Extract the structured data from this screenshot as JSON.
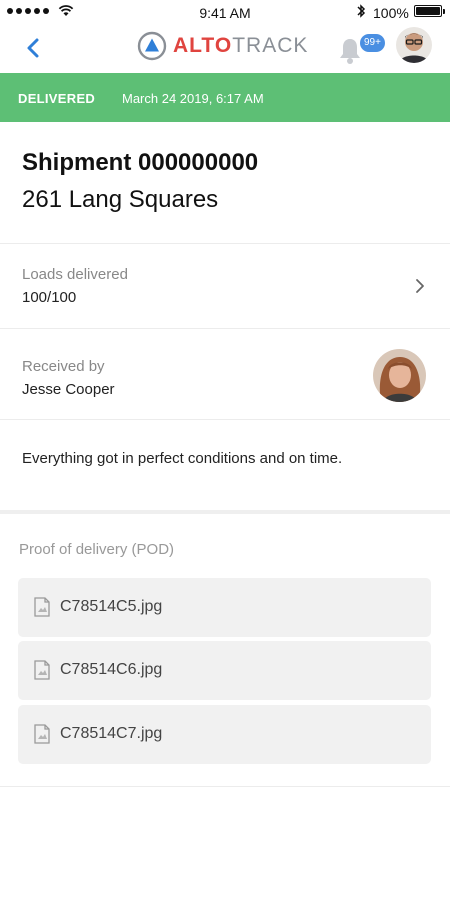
{
  "status_bar": {
    "time": "9:41 AM",
    "battery": "100%"
  },
  "header": {
    "logo_alto": "ALTO",
    "logo_track": "TRACK",
    "notification_count": "99+"
  },
  "banner": {
    "status": "DELIVERED",
    "datetime": "March 24 2019, 6:17 AM",
    "color": "#5dbf75"
  },
  "shipment": {
    "title": "Shipment 000000000",
    "address": "261 Lang Squares"
  },
  "loads": {
    "label": "Loads delivered",
    "value": "100/100"
  },
  "receiver": {
    "label": "Received by",
    "name": "Jesse Cooper"
  },
  "note": "Everything got in perfect conditions and on time.",
  "pod": {
    "label": "Proof of delivery (POD)",
    "files": [
      "C78514C5.jpg",
      "C78514C6.jpg",
      "C78514C7.jpg"
    ]
  },
  "colors": {
    "accent_red": "#e0443f",
    "badge_blue": "#4a8fe2",
    "back_blue": "#2f7fd8"
  }
}
